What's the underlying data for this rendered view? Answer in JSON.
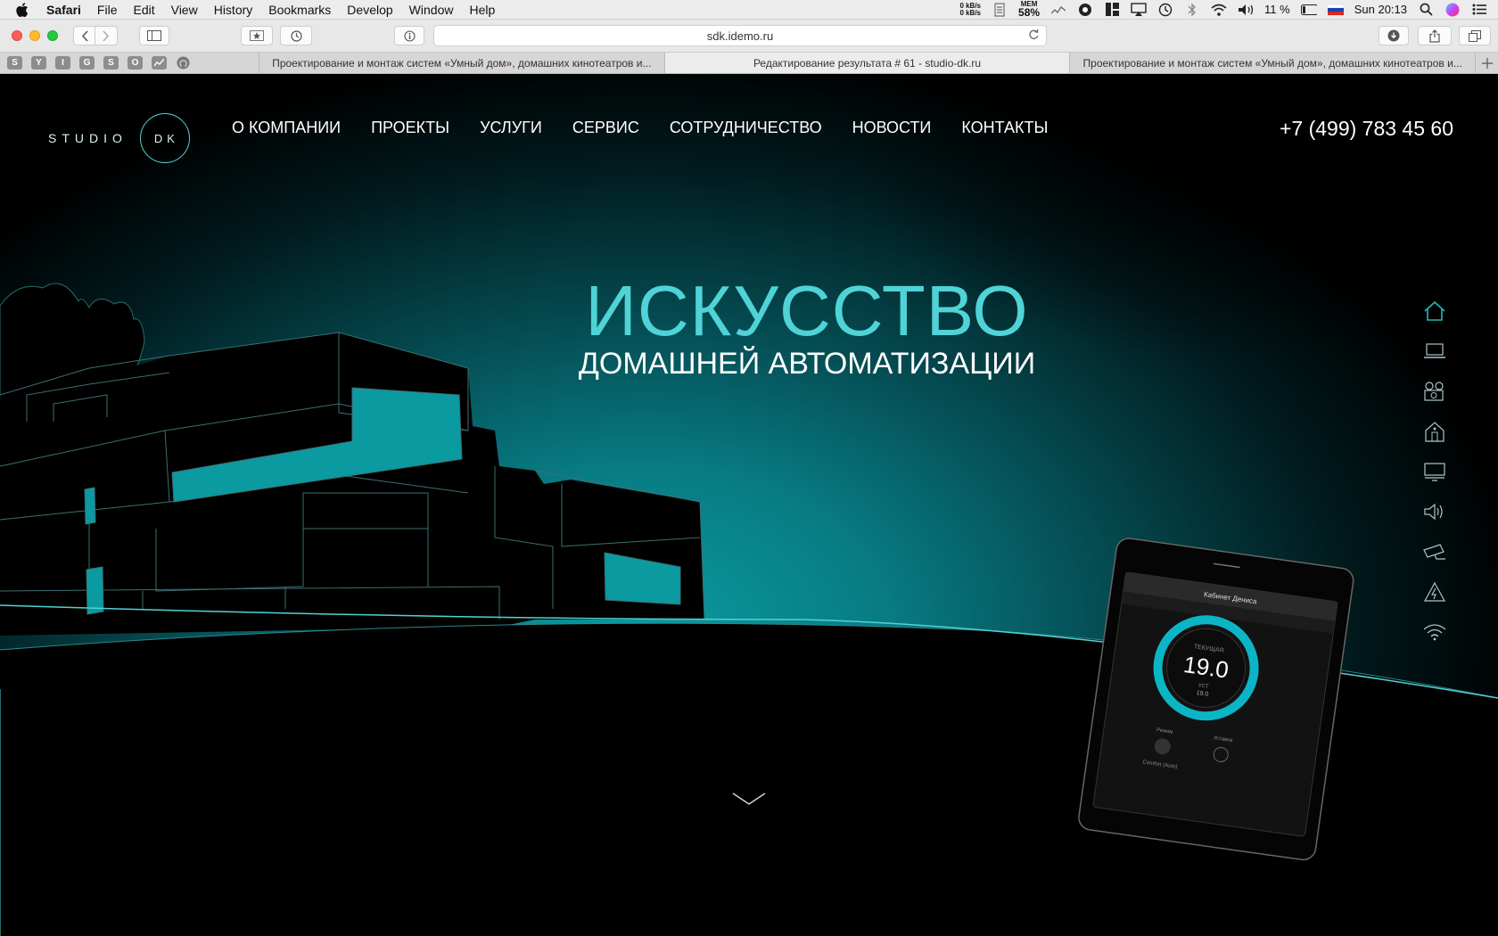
{
  "menubar": {
    "app": "Safari",
    "items": [
      "File",
      "Edit",
      "View",
      "History",
      "Bookmarks",
      "Develop",
      "Window",
      "Help"
    ],
    "net_up": "0 kB/s",
    "net_down": "0 kB/s",
    "mem_label": "MEM",
    "mem_value": "58%",
    "battery": "11 %",
    "clock": "Sun 20:13"
  },
  "browser": {
    "url": "sdk.idemo.ru",
    "pinned": [
      "S",
      "Y",
      "I",
      "G",
      "S",
      "O",
      "",
      ""
    ],
    "tabs": [
      {
        "title": "Проектирование и монтаж систем «Умный дом», домашних кинотеатров и...",
        "active": false
      },
      {
        "title": "Редактирование результата # 61 - studio-dk.ru",
        "active": true
      },
      {
        "title": "Проектирование и монтаж систем «Умный дом», домашних кинотеатров и...",
        "active": false
      }
    ]
  },
  "site": {
    "logo_text": "STUDIO",
    "logo_mark": "DK",
    "nav": [
      "О КОМПАНИИ",
      "ПРОЕКТЫ",
      "УСЛУГИ",
      "СЕРВИС",
      "СОТРУДНИЧЕСТВО",
      "НОВОСТИ",
      "КОНТАКТЫ"
    ],
    "phone": "+7 (499) 783 45 60",
    "hero_title": "ИСКУССТВО",
    "hero_subtitle": "ДОМАШНЕЙ АВТОМАТИЗАЦИИ",
    "side_icons": [
      "home-icon",
      "laptop-icon",
      "projector-icon",
      "smart-house-icon",
      "monitor-icon",
      "speaker-icon",
      "security-camera-icon",
      "power-icon",
      "wifi-icon"
    ],
    "tablet": {
      "room": "Кабинет Дениса",
      "reading_label": "ТЕКУЩАЯ",
      "temperature": "19.0",
      "setpoint_label": "УСТ",
      "setpoint": "19.0",
      "mode_label": "Режим",
      "mode_value": "Comfort (Auto)",
      "settings_label": "Уставка"
    }
  },
  "colors": {
    "accent": "#4fd3d6",
    "teal": "#0a9aa0"
  }
}
